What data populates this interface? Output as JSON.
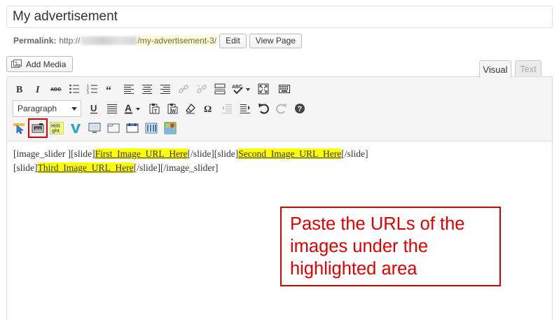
{
  "post": {
    "title": "My advertisement"
  },
  "permalink": {
    "label": "Permalink:",
    "domain_prefix": "http://",
    "slug": "/my-advertisement-3/",
    "edit_label": "Edit",
    "view_label": "View Page"
  },
  "media": {
    "add_label": "Add Media"
  },
  "tabs": {
    "visual": "Visual",
    "text": "Text"
  },
  "toolbar": {
    "row1": [
      "bold-icon",
      "italic-icon",
      "strikethrough-icon",
      "bullet-list-icon",
      "numbered-list-icon",
      "blockquote-icon",
      "align-left-icon",
      "align-center-icon",
      "align-right-icon",
      "link-icon",
      "unlink-icon",
      "more-tag-icon",
      "spellcheck-icon",
      "fullscreen-icon",
      "kitchen-sink-icon"
    ],
    "format_value": "Paragraph",
    "row2": [
      "underline-icon",
      "justify-icon",
      "text-color-icon",
      "paste-text-icon",
      "paste-word-icon",
      "clear-formatting-icon",
      "special-character-icon",
      "outdent-icon",
      "indent-icon",
      "undo-icon",
      "redo-icon",
      "help-icon"
    ],
    "row3": [
      "cursor-plugin-icon",
      "image-slider-plugin-icon",
      "highlight-plugin-icon",
      "vimeo-plugin-icon",
      "monitor-plugin-icon",
      "panel-plugin-icon",
      "table-plugin-icon",
      "columns-plugin-icon",
      "map-plugin-icon"
    ],
    "highlight_plugin_label": "Hilli ght"
  },
  "content": {
    "line1": [
      {
        "text": "[image_slider ][slide]",
        "hl": false
      },
      {
        "text": "First_Image_URL_Here",
        "hl": true
      },
      {
        "text": "[/slide][slide]",
        "hl": false
      },
      {
        "text": "Second_Image_URL_Here",
        "hl": true
      },
      {
        "text": "[/slide]",
        "hl": false
      }
    ],
    "line2": [
      {
        "text": "[slide]",
        "hl": false
      },
      {
        "text": "Third_Image_URL_Here",
        "hl": true
      },
      {
        "text": "[/slide][/image_slider]",
        "hl": false
      }
    ]
  },
  "callout": {
    "lines": [
      "Paste the URLs of the",
      "images under the",
      "highlighted area"
    ]
  },
  "colors": {
    "highlight": "#ffff00",
    "callout_red": "#e00000",
    "slug_bg": "#fffbcc"
  }
}
